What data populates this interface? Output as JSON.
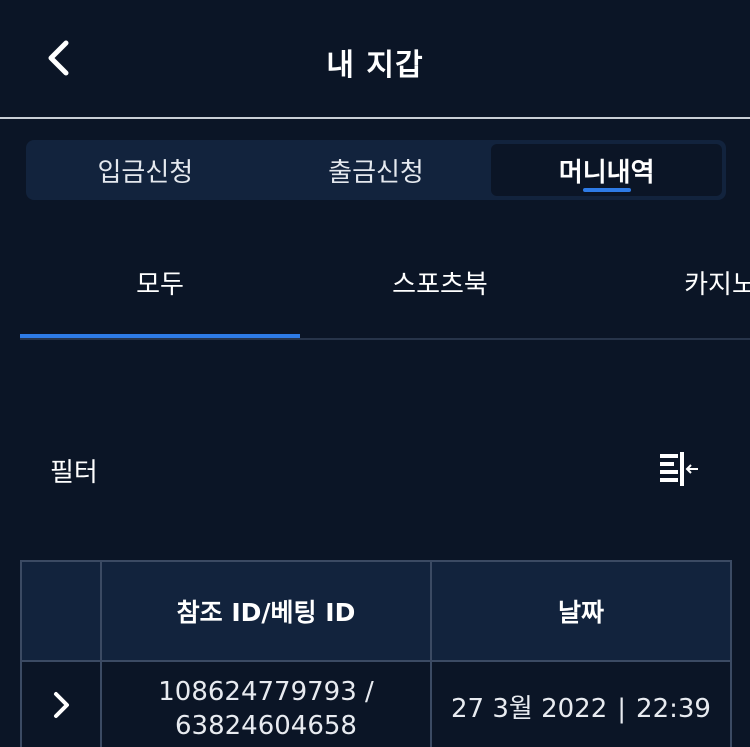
{
  "header": {
    "title": "내 지갑"
  },
  "wallet_tabs": [
    {
      "label": "입금신청",
      "active": false
    },
    {
      "label": "출금신청",
      "active": false
    },
    {
      "label": "머니내역",
      "active": true
    }
  ],
  "category_tabs": [
    {
      "label": "모두",
      "active": true
    },
    {
      "label": "스포츠북",
      "active": false
    },
    {
      "label": "카지노",
      "active": false
    }
  ],
  "filter": {
    "label": "필터"
  },
  "table": {
    "columns": [
      "",
      "참조 ID/베팅 ID",
      "날짜"
    ],
    "rows": [
      {
        "ref_line1": "108624779793 /",
        "ref_line2": "63824604658",
        "date": "27 3월 2022",
        "time": "22:39"
      }
    ]
  },
  "colors": {
    "background": "#0b1526",
    "panel": "#12233d",
    "accent": "#2e7be6",
    "border": "#3b4a63"
  }
}
